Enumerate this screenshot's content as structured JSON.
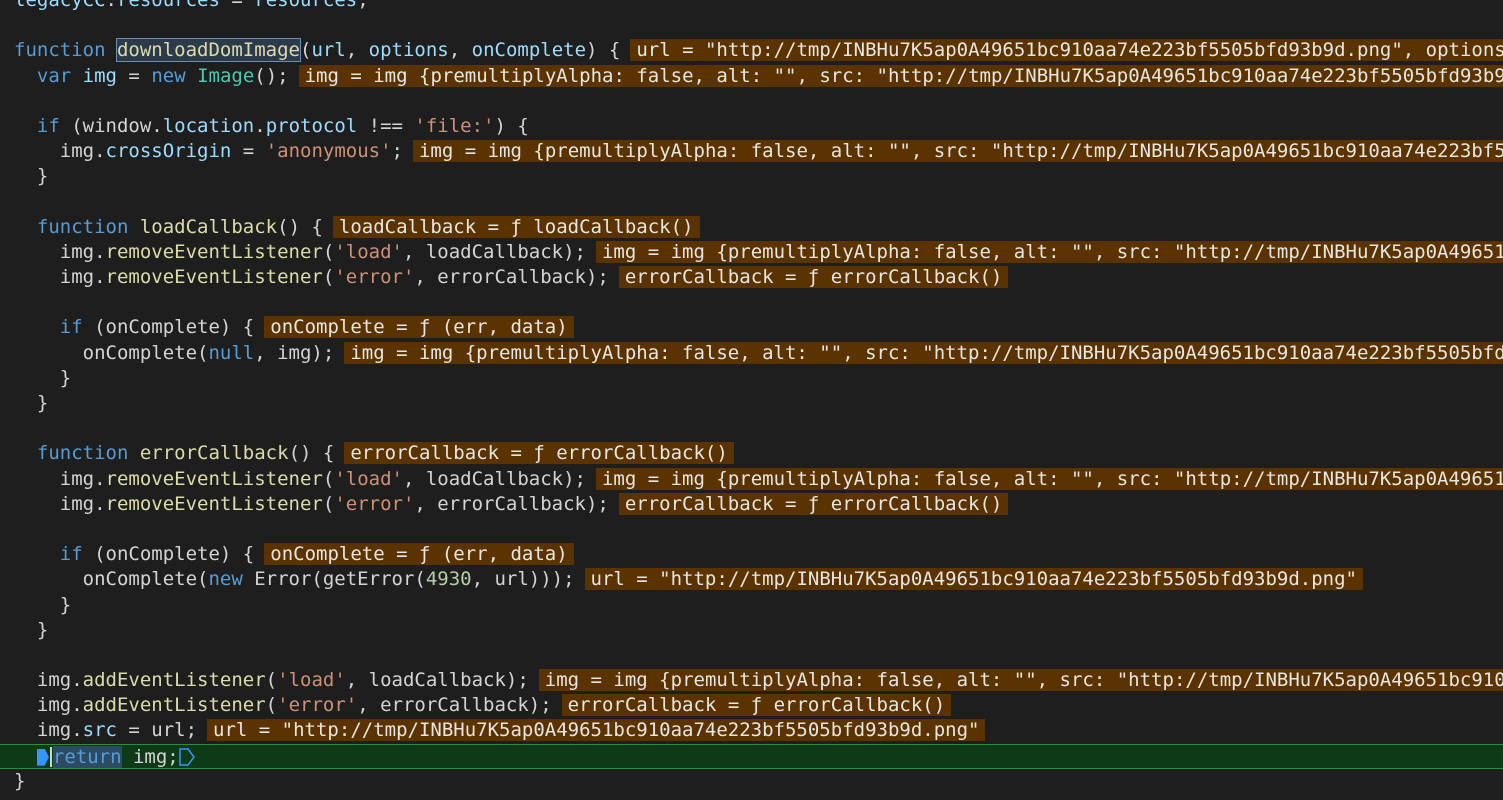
{
  "lines": [
    {
      "segs": [
        [
          "vr",
          "legacyCC"
        ],
        [
          "pl",
          "."
        ],
        [
          "vr",
          "resources"
        ],
        [
          "pl",
          " = "
        ],
        [
          "vr",
          "resources"
        ],
        [
          "pl",
          ";"
        ]
      ]
    },
    {
      "segs": []
    },
    {
      "segs": [
        [
          "kw",
          "function "
        ],
        [
          "fnbox",
          "downloadDomImage"
        ],
        [
          "pl",
          "("
        ],
        [
          "vr",
          "url"
        ],
        [
          "pl",
          ", "
        ],
        [
          "vr",
          "options"
        ],
        [
          "pl",
          ", "
        ],
        [
          "vr",
          "onComplete"
        ],
        [
          "pl",
          ") {"
        ]
      ],
      "inline": "url = \"http://tmp/INBHu7K5ap0A49651bc910aa74e223bf5505bfd93b9d.png\", options = {…}, onComplete = ƒ (err, data)"
    },
    {
      "segs": [
        [
          "pl",
          "  "
        ],
        [
          "kw",
          "var "
        ],
        [
          "vr",
          "img"
        ],
        [
          "pl",
          " = "
        ],
        [
          "kw",
          "new "
        ],
        [
          "cl",
          "Image"
        ],
        [
          "pl",
          "();"
        ]
      ],
      "inline": "img = img {premultiplyAlpha: false, alt: \"\", src: \"http://tmp/INBHu7K5ap0A49651bc910aa74e223bf5505bfd93b9d.png\", srcset: \"\"}"
    },
    {
      "segs": []
    },
    {
      "segs": [
        [
          "pl",
          "  "
        ],
        [
          "kw",
          "if "
        ],
        [
          "pl",
          "(window."
        ],
        [
          "vr",
          "location"
        ],
        [
          "pl",
          "."
        ],
        [
          "vr",
          "protocol"
        ],
        [
          "pl",
          " !== "
        ],
        [
          "st",
          "'file:'"
        ],
        [
          "pl",
          ") {"
        ]
      ]
    },
    {
      "segs": [
        [
          "pl",
          "    img."
        ],
        [
          "vr",
          "crossOrigin"
        ],
        [
          "pl",
          " = "
        ],
        [
          "st",
          "'anonymous'"
        ],
        [
          "pl",
          ";"
        ]
      ],
      "inline": "img = img {premultiplyAlpha: false, alt: \"\", src: \"http://tmp/INBHu7K5ap0A49651bc910aa74e223bf5505bfd93b9d.png\"}"
    },
    {
      "segs": [
        [
          "pl",
          "  }"
        ]
      ]
    },
    {
      "segs": []
    },
    {
      "segs": [
        [
          "pl",
          "  "
        ],
        [
          "kw",
          "function "
        ],
        [
          "fn",
          "loadCallback"
        ],
        [
          "pl",
          "() {"
        ]
      ],
      "inline": "loadCallback = ƒ loadCallback()"
    },
    {
      "segs": [
        [
          "pl",
          "    img."
        ],
        [
          "fn",
          "removeEventListener"
        ],
        [
          "pl",
          "("
        ],
        [
          "st",
          "'load'"
        ],
        [
          "pl",
          ", loadCallback);"
        ]
      ],
      "inline": "img = img {premultiplyAlpha: false, alt: \"\", src: \"http://tmp/INBHu7K5ap0A49651bc910aa74e223bf5505bfd93b9d.png\"}"
    },
    {
      "segs": [
        [
          "pl",
          "    img."
        ],
        [
          "fn",
          "removeEventListener"
        ],
        [
          "pl",
          "("
        ],
        [
          "st",
          "'error'"
        ],
        [
          "pl",
          ", errorCallback);"
        ]
      ],
      "inline": "errorCallback = ƒ errorCallback()"
    },
    {
      "segs": []
    },
    {
      "segs": [
        [
          "pl",
          "    "
        ],
        [
          "kw",
          "if "
        ],
        [
          "pl",
          "(onComplete) {"
        ]
      ],
      "inline": "onComplete = ƒ (err, data)"
    },
    {
      "segs": [
        [
          "pl",
          "      onComplete("
        ],
        [
          "kw",
          "null"
        ],
        [
          "pl",
          ", img);"
        ]
      ],
      "inline": "img = img {premultiplyAlpha: false, alt: \"\", src: \"http://tmp/INBHu7K5ap0A49651bc910aa74e223bf5505bfd93b9d.png\"}"
    },
    {
      "segs": [
        [
          "pl",
          "    }"
        ]
      ]
    },
    {
      "segs": [
        [
          "pl",
          "  }"
        ]
      ]
    },
    {
      "segs": []
    },
    {
      "segs": [
        [
          "pl",
          "  "
        ],
        [
          "kw",
          "function "
        ],
        [
          "fn",
          "errorCallback"
        ],
        [
          "pl",
          "() {"
        ]
      ],
      "inline": "errorCallback = ƒ errorCallback()"
    },
    {
      "segs": [
        [
          "pl",
          "    img."
        ],
        [
          "fn",
          "removeEventListener"
        ],
        [
          "pl",
          "("
        ],
        [
          "st",
          "'load'"
        ],
        [
          "pl",
          ", loadCallback);"
        ]
      ],
      "inline": "img = img {premultiplyAlpha: false, alt: \"\", src: \"http://tmp/INBHu7K5ap0A49651bc910aa74e223bf5505bfd93b9d.png\"}"
    },
    {
      "segs": [
        [
          "pl",
          "    img."
        ],
        [
          "fn",
          "removeEventListener"
        ],
        [
          "pl",
          "("
        ],
        [
          "st",
          "'error'"
        ],
        [
          "pl",
          ", errorCallback);"
        ]
      ],
      "inline": "errorCallback = ƒ errorCallback()"
    },
    {
      "segs": []
    },
    {
      "segs": [
        [
          "pl",
          "    "
        ],
        [
          "kw",
          "if "
        ],
        [
          "pl",
          "(onComplete) {"
        ]
      ],
      "inline": "onComplete = ƒ (err, data)"
    },
    {
      "segs": [
        [
          "pl",
          "      onComplete("
        ],
        [
          "kw",
          "new "
        ],
        [
          "pl",
          "Error(getError("
        ],
        [
          "nm",
          "4930"
        ],
        [
          "pl",
          ", url)));"
        ]
      ],
      "inline": "url = \"http://tmp/INBHu7K5ap0A49651bc910aa74e223bf5505bfd93b9d.png\""
    },
    {
      "segs": [
        [
          "pl",
          "    }"
        ]
      ]
    },
    {
      "segs": [
        [
          "pl",
          "  }"
        ]
      ]
    },
    {
      "segs": []
    },
    {
      "segs": [
        [
          "pl",
          "  img."
        ],
        [
          "fn",
          "addEventListener"
        ],
        [
          "pl",
          "("
        ],
        [
          "st",
          "'load'"
        ],
        [
          "pl",
          ", loadCallback);"
        ]
      ],
      "inline": "img = img {premultiplyAlpha: false, alt: \"\", src: \"http://tmp/INBHu7K5ap0A49651bc910aa74e223bf5505bfd93b9d.png\"}"
    },
    {
      "segs": [
        [
          "pl",
          "  img."
        ],
        [
          "fn",
          "addEventListener"
        ],
        [
          "pl",
          "("
        ],
        [
          "st",
          "'error'"
        ],
        [
          "pl",
          ", errorCallback);"
        ]
      ],
      "inline": "errorCallback = ƒ errorCallback()"
    },
    {
      "segs": [
        [
          "pl",
          "  img."
        ],
        [
          "vr",
          "src"
        ],
        [
          "pl",
          " = url;"
        ]
      ],
      "inline": "url = \"http://tmp/INBHu7K5ap0A49651bc910aa74e223bf5505bfd93b9d.png\""
    },
    {
      "current": true,
      "segs": [
        [
          "pl",
          "  "
        ],
        [
          "bp",
          ""
        ],
        [
          "returnkw",
          "return"
        ],
        [
          "pl",
          " img;"
        ],
        [
          "bpo",
          ""
        ]
      ]
    },
    {
      "segs": [
        [
          "pl",
          "}"
        ]
      ]
    }
  ]
}
